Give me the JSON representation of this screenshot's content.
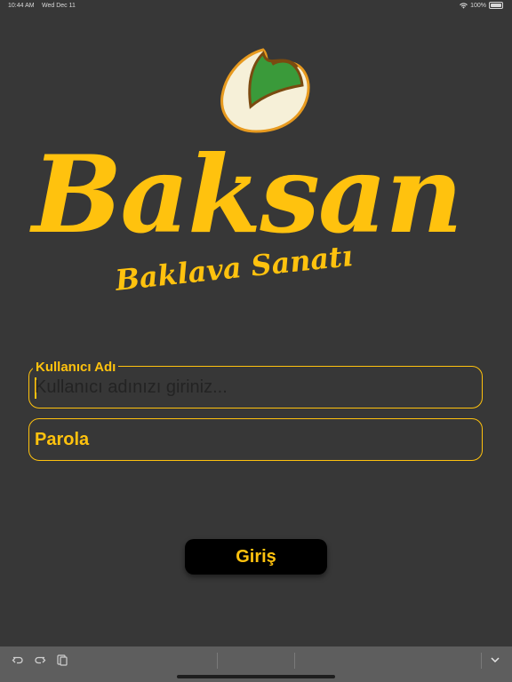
{
  "status_bar": {
    "time": "10:44 AM",
    "date": "Wed Dec 11",
    "battery": "100%"
  },
  "brand": {
    "name": "Baksan",
    "tagline": "Baklava Sanatı",
    "logo": "pistachio-icon",
    "color": "#ffc20e"
  },
  "form": {
    "username": {
      "label": "Kullanıcı Adı",
      "placeholder": "Kullanıcı adınızı giriniz...",
      "value": ""
    },
    "password": {
      "label": "Parola"
    },
    "submit_label": "Giriş"
  },
  "keyboard_bar": {
    "icons": [
      "undo-icon",
      "redo-icon",
      "paste-icon",
      "chevron-down-icon"
    ]
  }
}
